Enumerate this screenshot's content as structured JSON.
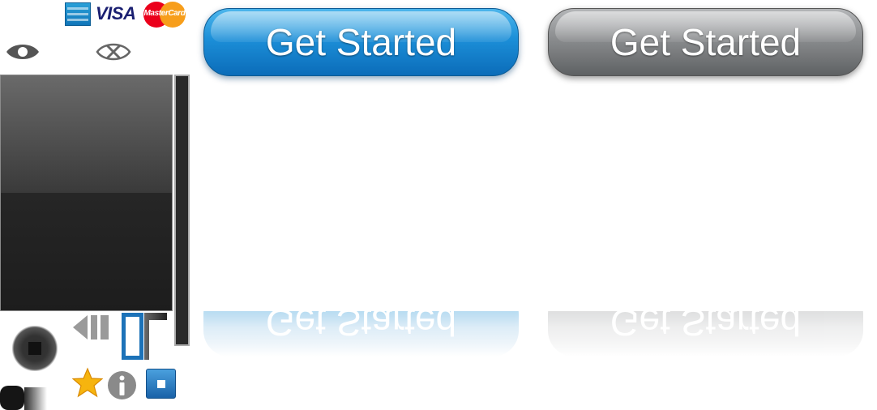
{
  "payment_logos": {
    "amex_icon": "american-express-logo-icon",
    "visa_label": "VISA",
    "mastercard_label": "MasterCard"
  },
  "buttons": {
    "primary_label": "Get Started",
    "secondary_label": "Get Started"
  },
  "colors": {
    "primary_button": "#1c8fd8",
    "secondary_button": "#8a8c8e",
    "visa_blue": "#1a1f71",
    "mastercard_red": "#eb001b",
    "mastercard_orange": "#f79e1b",
    "star_gold": "#f6b40e"
  },
  "icons": [
    "eye-icon",
    "close-circle-icon",
    "back-icon",
    "star-icon",
    "info-icon",
    "stop-icon"
  ]
}
